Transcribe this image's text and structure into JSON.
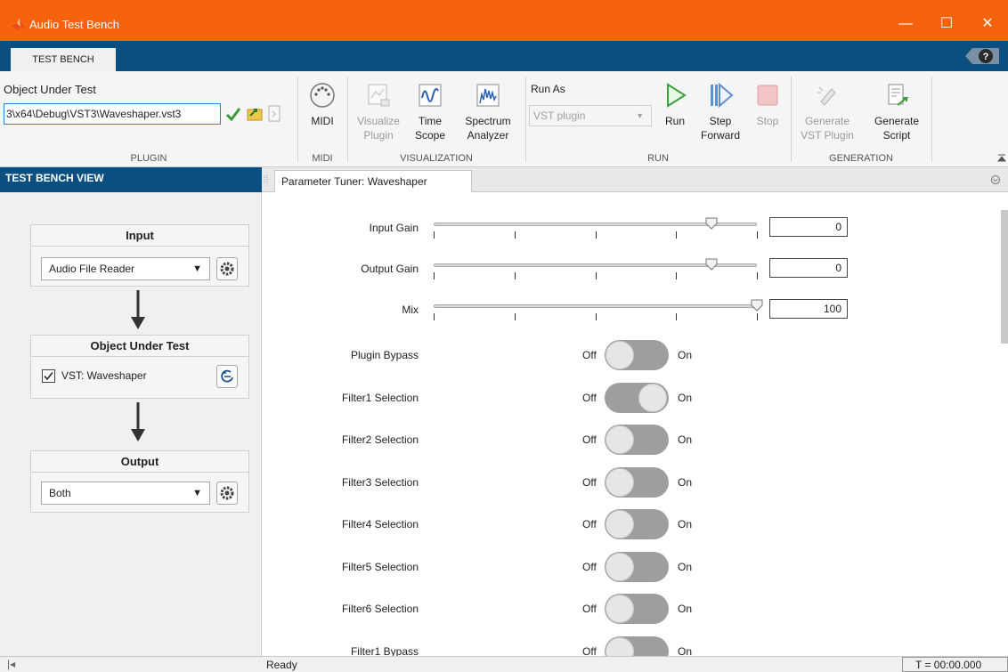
{
  "window": {
    "title": "Audio Test Bench",
    "minimize": "—",
    "maximize": "☐",
    "close": "✕"
  },
  "tabs": {
    "active": "TEST BENCH",
    "help": "?"
  },
  "ribbon": {
    "plugin": {
      "label": "Object Under Test",
      "path_value": "3\\x64\\Debug\\VST3\\Waveshaper.vst3",
      "section": "PLUGIN"
    },
    "midi": {
      "button": "MIDI",
      "section": "MIDI"
    },
    "visualization": {
      "visualize": [
        "Visualize",
        "Plugin"
      ],
      "time_scope": [
        "Time",
        "Scope"
      ],
      "spectrum": [
        "Spectrum",
        "Analyzer"
      ],
      "section": "VISUALIZATION"
    },
    "run": {
      "run_as_label": "Run As",
      "run_as_value": "VST plugin",
      "run": "Run",
      "step": [
        "Step",
        "Forward"
      ],
      "stop": "Stop",
      "section": "RUN"
    },
    "generation": {
      "gen_vst": [
        "Generate",
        "VST Plugin"
      ],
      "gen_script": [
        "Generate",
        "Script"
      ],
      "section": "GENERATION"
    }
  },
  "left": {
    "header": "TEST BENCH VIEW",
    "input": {
      "title": "Input",
      "source": "Audio File Reader"
    },
    "out": {
      "title": "Object Under Test",
      "item": "VST: Waveshaper",
      "checked": true
    },
    "output": {
      "title": "Output",
      "dest": "Both"
    }
  },
  "tuner": {
    "tab": "Parameter Tuner: Waveshaper",
    "sliders": [
      {
        "label": "Input Gain",
        "value": "0",
        "fraction": 0.86
      },
      {
        "label": "Output Gain",
        "value": "0",
        "fraction": 0.86
      },
      {
        "label": "Mix",
        "value": "100",
        "fraction": 1.0
      }
    ],
    "off": "Off",
    "on": "On",
    "switches": [
      {
        "label": "Plugin Bypass",
        "on": false
      },
      {
        "label": "Filter1 Selection",
        "on": true
      },
      {
        "label": "Filter2 Selection",
        "on": false
      },
      {
        "label": "Filter3 Selection",
        "on": false
      },
      {
        "label": "Filter4 Selection",
        "on": false
      },
      {
        "label": "Filter5 Selection",
        "on": false
      },
      {
        "label": "Filter6 Selection",
        "on": false
      },
      {
        "label": "Filter1 Bypass",
        "on": false
      }
    ]
  },
  "status": {
    "text": "Ready",
    "time": "T = 00:00.000"
  }
}
